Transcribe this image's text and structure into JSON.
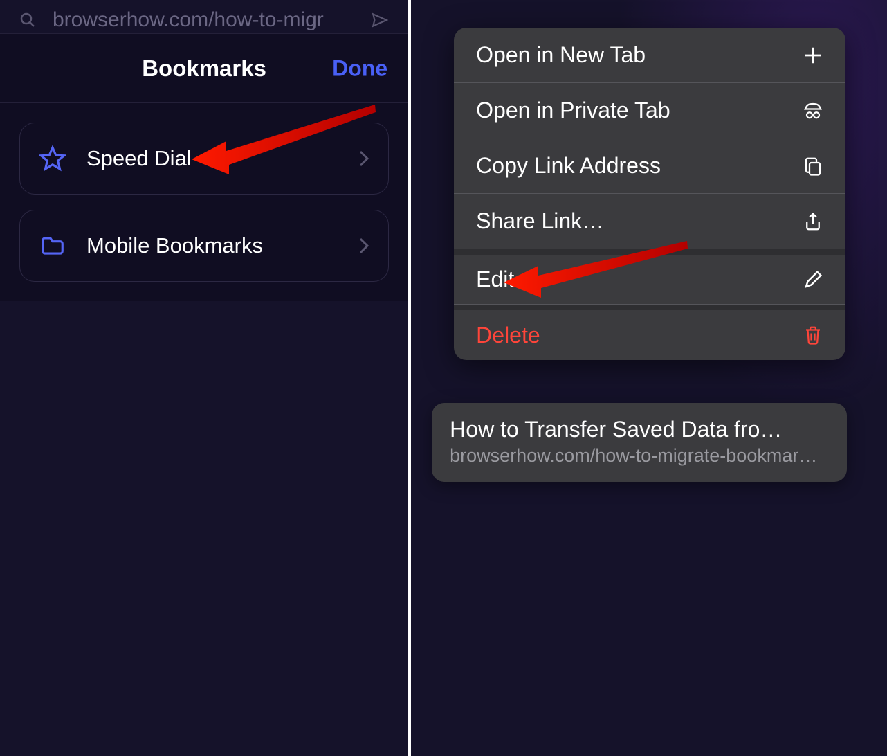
{
  "left": {
    "address_bar_text": "browserhow.com/how-to-migr",
    "sheet_title": "Bookmarks",
    "done_label": "Done",
    "folders": [
      {
        "label": "Speed Dial",
        "icon": "star"
      },
      {
        "label": "Mobile Bookmarks",
        "icon": "folder"
      }
    ]
  },
  "context_menu": [
    {
      "label": "Open in New Tab",
      "icon": "plus"
    },
    {
      "label": "Open in Private Tab",
      "icon": "incognito"
    },
    {
      "label": "Copy Link Address",
      "icon": "copy"
    },
    {
      "label": "Share Link…",
      "icon": "share"
    },
    {
      "label": "Edit",
      "icon": "pencil",
      "sep_above": true
    },
    {
      "label": "Delete",
      "icon": "trash",
      "sep_above": true,
      "danger": true
    }
  ],
  "bookmark_preview": {
    "title": "How to Transfer Saved Data fro…",
    "url": "browserhow.com/how-to-migrate-bookmar…"
  }
}
